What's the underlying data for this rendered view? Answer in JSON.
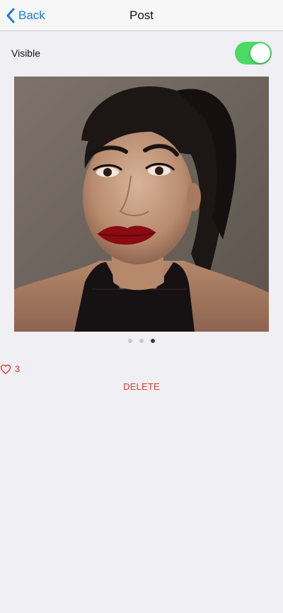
{
  "navbar": {
    "back_label": "Back",
    "title": "Post"
  },
  "visibility": {
    "label": "Visible",
    "enabled": true,
    "toggle_color": "#4cd964"
  },
  "photo": {
    "pager_count": 3,
    "active_index": 2
  },
  "likes": {
    "count": "3",
    "icon": "heart-outline-icon",
    "color": "#e53935"
  },
  "actions": {
    "delete_label": "DELETE"
  },
  "colors": {
    "accent": "#1a7fd6",
    "danger": "#e53935",
    "background": "#efeff4"
  }
}
